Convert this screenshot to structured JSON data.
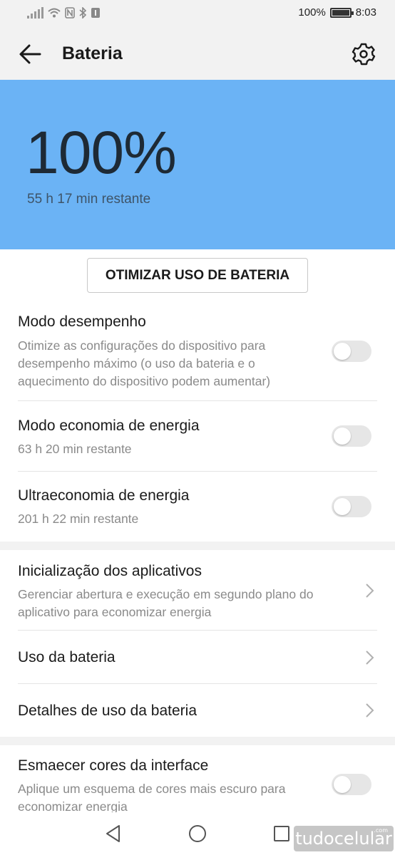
{
  "status_bar": {
    "battery_text": "100%",
    "time": "8:03",
    "battery_level": 1.0
  },
  "app_bar": {
    "title": "Bateria",
    "back_icon": "arrow-left-icon",
    "settings_icon": "gear-icon"
  },
  "hero": {
    "percent": "100%",
    "remaining": "55 h 17 min restante",
    "color": "#6bb3f5"
  },
  "optimize_button": "OTIMIZAR USO DE BATERIA",
  "settings": [
    {
      "title": "Modo desempenho",
      "subtitle": "Otimize as configurações do dispositivo para desempenho máximo (o uso da bateria e o aquecimento do dispositivo podem aumentar)",
      "control": "toggle",
      "enabled": false
    },
    {
      "title": "Modo economia de energia",
      "subtitle": "63 h 20 min restante",
      "control": "toggle",
      "enabled": false
    },
    {
      "title": "Ultraeconomia de energia",
      "subtitle": "201 h 22 min restante",
      "control": "toggle",
      "enabled": false
    },
    {
      "title": "Inicialização dos aplicativos",
      "subtitle": "Gerenciar abertura e execução em segundo plano do aplicativo para economizar energia",
      "control": "chevron"
    },
    {
      "title": "Uso da bateria",
      "control": "chevron"
    },
    {
      "title": "Detalhes de uso da bateria",
      "control": "chevron"
    },
    {
      "title": "Esmaecer cores da interface",
      "subtitle": "Aplique um esquema de cores mais escuro para economizar energia",
      "control": "toggle",
      "enabled": false
    }
  ],
  "watermark": {
    "text": "tudocelular",
    "suffix": ".com"
  }
}
